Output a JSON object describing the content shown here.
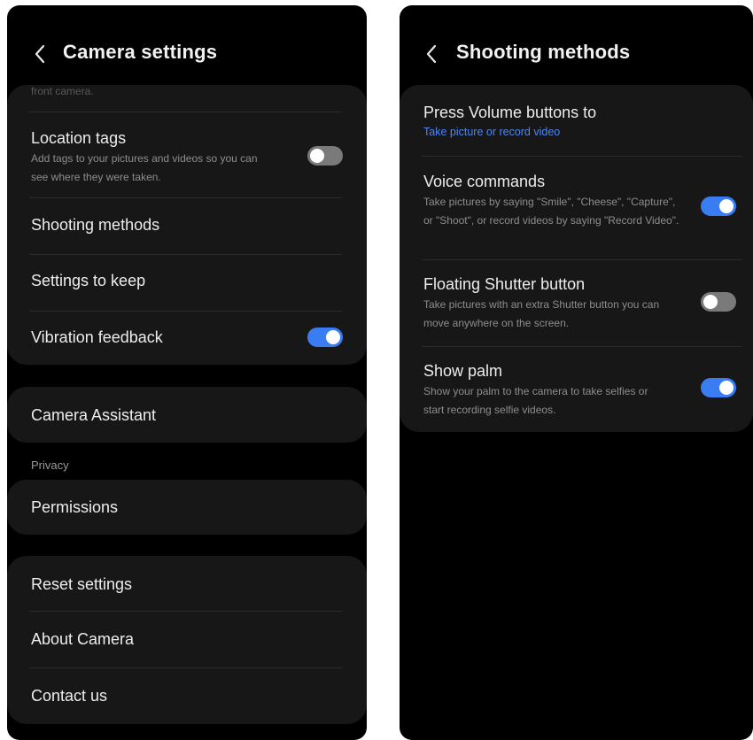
{
  "left": {
    "title": "Camera settings",
    "partial_text": "front camera.",
    "location_tags": {
      "title": "Location tags",
      "subtitle": "Add tags to your pictures and videos so you can see where they were taken.",
      "state": "off"
    },
    "shooting_methods": "Shooting methods",
    "settings_to_keep": "Settings to keep",
    "vibration_feedback": {
      "title": "Vibration feedback",
      "state": "on"
    },
    "camera_assistant": "Camera Assistant",
    "privacy_label": "Privacy",
    "permissions": "Permissions",
    "reset_settings": "Reset settings",
    "about_camera": "About Camera",
    "contact_us": "Contact us"
  },
  "right": {
    "title": "Shooting methods",
    "press_volume": {
      "title": "Press Volume buttons to",
      "value": "Take picture or record video"
    },
    "voice_commands": {
      "title": "Voice commands",
      "subtitle": "Take pictures by saying \"Smile\", \"Cheese\", \"Capture\", or \"Shoot\", or record videos by saying \"Record Video\".",
      "state": "on"
    },
    "floating_shutter": {
      "title": "Floating Shutter button",
      "subtitle": "Take pictures with an extra Shutter button you can move anywhere on the screen.",
      "state": "off"
    },
    "show_palm": {
      "title": "Show palm",
      "subtitle": "Show your palm to the camera to take selfies or start recording selfie videos.",
      "state": "on"
    }
  },
  "colors": {
    "background": "#000000",
    "card": "#171717",
    "accent": "#3a7cf2",
    "link": "#4f86f3",
    "toggle_off": "#7a7a7a"
  },
  "icons": {
    "back": "chevron-left-icon"
  }
}
